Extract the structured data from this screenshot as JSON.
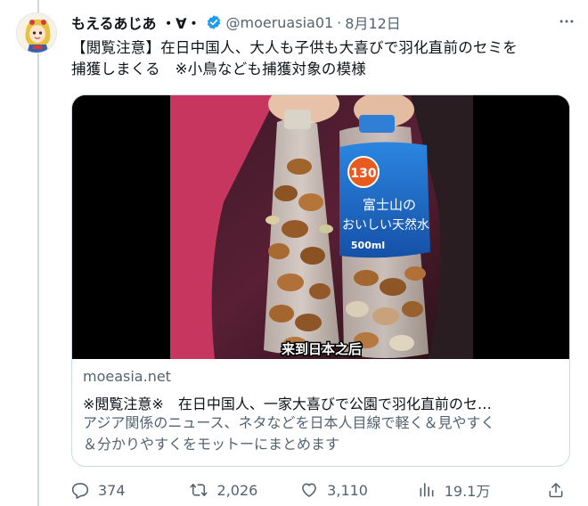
{
  "tweet": {
    "display_name": "もえるあじあ ・∀・",
    "handle": "@moeruasia01",
    "separator": "·",
    "date": "8月12日",
    "text_lines": [
      "【閲覧注意】在日中国人、大人も子供も大喜びで羽化直前のセミを",
      "捕獲しまくる　※小鳥なども捕獲対象の模様"
    ]
  },
  "card": {
    "domain": "moeasia.net",
    "title": "※閲覧注意※　在日中国人、一家大喜びで公園で羽化直前のセ…",
    "description_lines": [
      "アジア関係のニュース、ネタなどを日本人目線で軽く＆見やすく",
      "＆分かりやすくをモットーにまとめます"
    ],
    "media": {
      "bottle_brand_line1": "富士山の",
      "bottle_brand_line2": "おいしい天然水",
      "bottle_badge": "130",
      "bottle_volume": "500ml",
      "subtitle": "来到日本之后"
    }
  },
  "actions": {
    "replies": "374",
    "retweets": "2,026",
    "likes": "3,110",
    "views": "19.1万"
  },
  "icons": {
    "verified": "verified-badge-icon",
    "more": "more-dots-icon",
    "reply": "reply-bubble-icon",
    "retweet": "retweet-arrows-icon",
    "like": "heart-icon",
    "views": "views-bars-icon",
    "share": "share-upload-icon"
  },
  "colors": {
    "verified_blue": "#1d9bf0",
    "secondary_text": "#536471",
    "border": "#cfd9de",
    "bottle_label_blue": "#1f6fd0"
  }
}
